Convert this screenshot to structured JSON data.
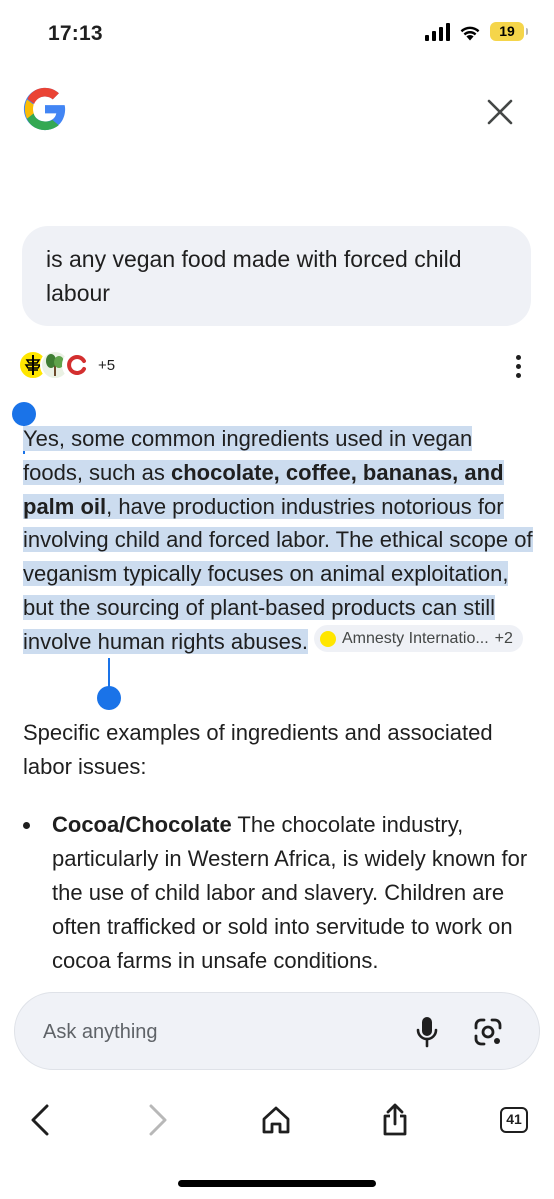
{
  "status_bar": {
    "time": "17:13",
    "battery": "19",
    "battery_color": "#f5d54a"
  },
  "header": {
    "logo_icon": "google-g-icon",
    "close_icon": "close-icon"
  },
  "query": {
    "text": "is any vegan food made with forced child labour"
  },
  "sources": {
    "favicons": [
      "amnesty-icon",
      "plant-icon",
      "red-ring-icon"
    ],
    "more_count": "+5"
  },
  "answer": {
    "p1_a": "Yes, some common ingredients used in vegan foods, such as ",
    "p1_bold": "chocolate, coffee, bananas, and palm oil",
    "p1_b": ", have production industries notorious for involving child and forced labor. The ethical scope of veganism typically focuses on animal exploitation, but the sourcing of plant-based products can still involve human rights abuses.",
    "chip_source": "Amnesty Internatio...",
    "chip_more": "+2",
    "highlight_color": "#ccdcef",
    "selection_color": "#1a73e8"
  },
  "section": {
    "subhead": "Specific examples of ingredients and associated labor issues:",
    "items": [
      {
        "title": "Cocoa/Chocolate",
        "text": " The chocolate industry, particularly in Western Africa, is widely known for the use of child labor and slavery. Children are often trafficked or sold into servitude to work on cocoa farms in unsafe conditions."
      }
    ]
  },
  "ask_bar": {
    "placeholder": "Ask anything",
    "mic_icon": "microphone-icon",
    "lens_icon": "google-lens-icon"
  },
  "toolbar": {
    "tabs_count": "41",
    "icons": [
      "back-arrow-icon",
      "forward-arrow-icon",
      "home-icon",
      "share-icon",
      "tabs-icon"
    ]
  }
}
